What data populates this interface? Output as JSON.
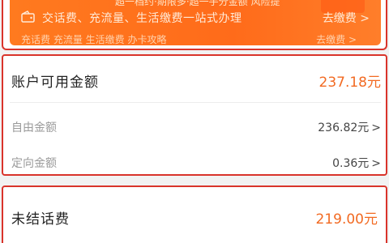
{
  "banner": {
    "top_text": "超一档约·期限多·超一手分金额 风险提",
    "icon": "wallet-icon",
    "row1_text": "交话费、充流量、生活缴费一站式办理",
    "cta_label": "去缴费 >",
    "row2_text": "充话费      充流量      生活缴费      办卡攻略",
    "row2_right": "去缴费 >",
    "color": "#ff6b1a"
  },
  "balance_card": {
    "title": "账户可用金额",
    "amount": "237.18元",
    "rows": [
      {
        "label": "自由金额",
        "value": "236.82元",
        "chevron": ">"
      },
      {
        "label": "定向金额",
        "value": "0.36元",
        "chevron": ">"
      }
    ],
    "amount_color": "#f26a22"
  },
  "unsettled_card": {
    "title": "未结话费",
    "amount": "219.00元"
  },
  "highlight_color": "#d9342b"
}
